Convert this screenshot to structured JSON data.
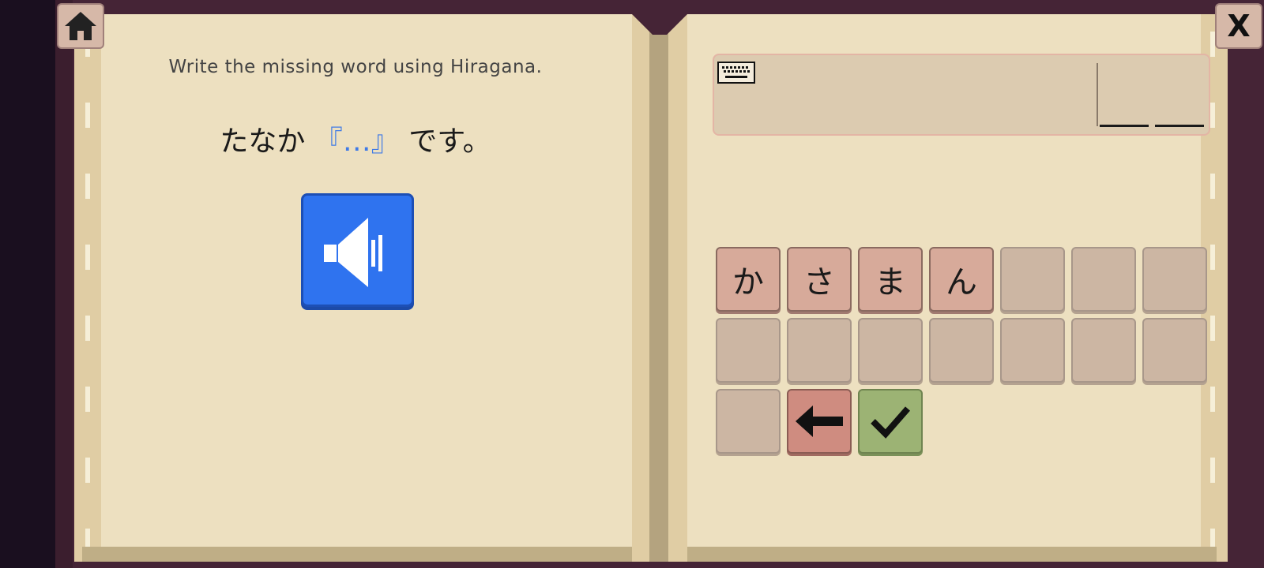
{
  "left_page": {
    "instruction": "Write the missing word using Hiragana.",
    "sentence_before": "たなか",
    "sentence_blank": "『…』",
    "sentence_after": "です。"
  },
  "controls": {
    "home_icon": "home-icon",
    "close_label": "X",
    "audio_icon": "speaker-icon"
  },
  "answer": {
    "keyboard_icon": "keyboard-icon",
    "slots": [
      "",
      ""
    ]
  },
  "keypad": {
    "keys": [
      "か",
      "さ",
      "ま",
      "ん",
      "",
      "",
      "",
      "",
      "",
      "",
      "",
      "",
      "",
      "",
      ""
    ],
    "backspace_icon": "arrow-left-icon",
    "submit_icon": "checkmark-icon"
  },
  "colors": {
    "page": "#ede0c0",
    "frame": "#452436",
    "audio_button": "#2f73ef",
    "blank_text": "#3f7ae6",
    "filled_key": "#d7aa9a",
    "empty_key": "#ccb6a3",
    "backspace_key": "#cf8c80",
    "submit_key": "#9cb374"
  }
}
